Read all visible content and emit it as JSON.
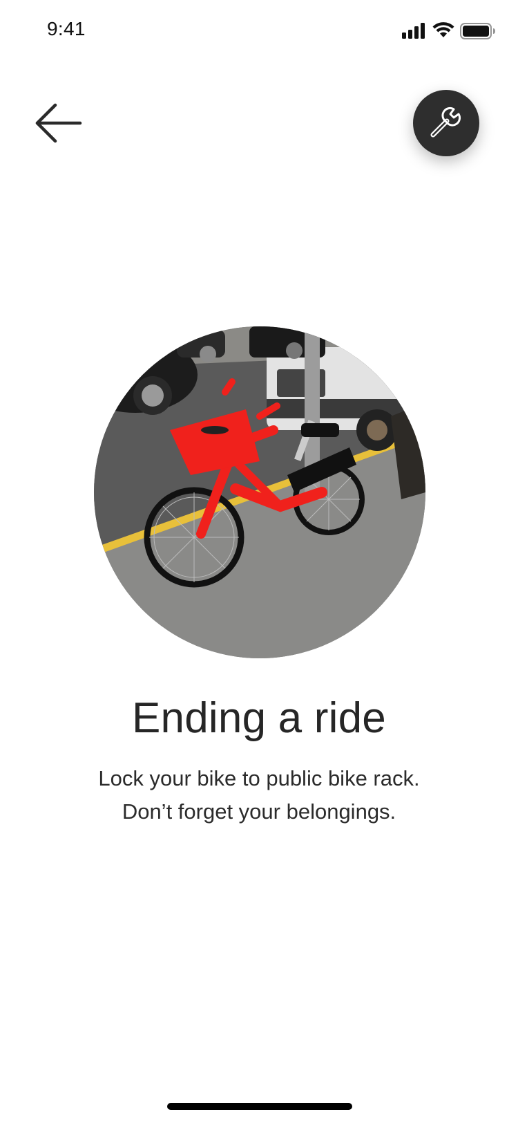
{
  "status_bar": {
    "time": "9:41",
    "icons": [
      "signal-icon",
      "wifi-icon",
      "battery-icon"
    ]
  },
  "header": {
    "back_icon": "arrow-left-icon",
    "tools_icon": "wrench-icon",
    "tools_button_color": "#2e2e2e"
  },
  "hero": {
    "image": "red-electric-bike-with-basket-on-sidewalk"
  },
  "content": {
    "title": "Ending a ride",
    "line1": "Lock your bike to public bike rack.",
    "line2": "Don’t forget your belongings."
  },
  "colors": {
    "bike_red": "#f0211c",
    "curb_yellow": "#e8c03a",
    "text": "#262626"
  }
}
